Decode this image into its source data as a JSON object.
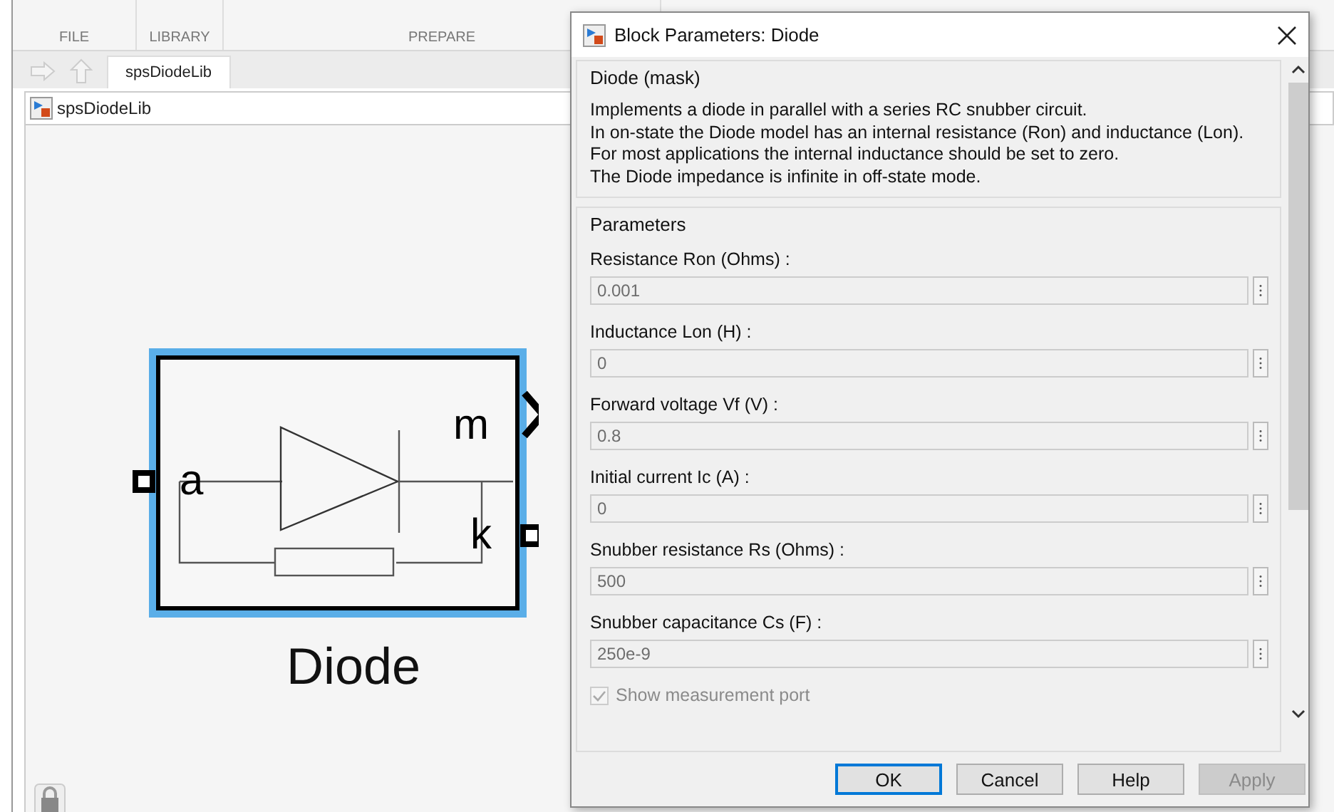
{
  "toolstrip": {
    "sections": [
      "FILE",
      "LIBRARY",
      "PREPARE"
    ]
  },
  "tabs": [
    {
      "label": "spsDiodeLib",
      "selected": true
    }
  ],
  "address": "spsDiodeLib",
  "block": {
    "name": "Diode",
    "selected": true,
    "port_labels": [
      "a",
      "m",
      "k"
    ]
  },
  "dialog": {
    "title": "Block Parameters: Diode",
    "mask_title": "Diode (mask)",
    "description": [
      "Implements a diode in parallel with a series RC snubber circuit.",
      "In on-state the Diode model has an internal resistance (Ron) and inductance (Lon).",
      "For most applications the internal inductance should be set to zero.",
      "The Diode impedance is infinite in off-state mode."
    ],
    "params_title": "Parameters",
    "params": [
      {
        "label": "Resistance Ron (Ohms) :",
        "value": "0.001",
        "disabled": true
      },
      {
        "label": "Inductance Lon (H) :",
        "value": "0",
        "disabled": true
      },
      {
        "label": "Forward voltage Vf (V) :",
        "value": "0.8",
        "disabled": true
      },
      {
        "label": "Initial current Ic (A) :",
        "value": "0",
        "disabled": true
      },
      {
        "label": "Snubber resistance Rs (Ohms) :",
        "value": "500",
        "disabled": true
      },
      {
        "label": "Snubber capacitance Cs (F) :",
        "value": "250e-9",
        "disabled": true
      }
    ],
    "checkbox": {
      "label": "Show measurement port",
      "checked": true,
      "disabled": true
    },
    "buttons": [
      {
        "label": "OK",
        "default": true,
        "disabled": false
      },
      {
        "label": "Cancel",
        "default": false,
        "disabled": false
      },
      {
        "label": "Help",
        "default": false,
        "disabled": false
      },
      {
        "label": "Apply",
        "default": false,
        "disabled": true
      }
    ]
  }
}
